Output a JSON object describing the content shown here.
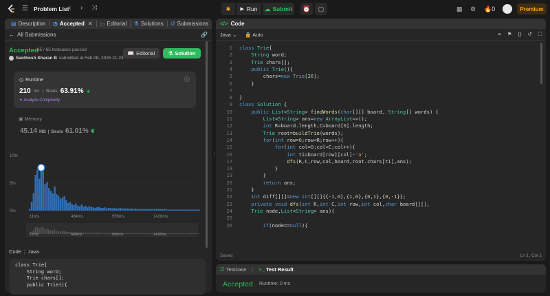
{
  "topbar": {
    "problem_list": "Problem List",
    "run": "Run",
    "submit": "Submit",
    "streak": "0",
    "premium": "Premium"
  },
  "left": {
    "tabs": [
      "Description",
      "Accepted",
      "Editorial",
      "Solutions",
      "Submissions"
    ],
    "all_submissions": "All Submissions",
    "status": "Accepted",
    "passed": "65 / 65 testcases passed",
    "user": "Santhosh Sharan B",
    "submitted": "submitted at Feb 08, 2025 21:23",
    "editorial_btn": "Editorial",
    "solution_btn": "Solution",
    "runtime_label": "Runtime",
    "runtime_value": "210",
    "runtime_unit": "ms",
    "beats_label": "Beats",
    "runtime_pct": "63.91%",
    "analyze": "Analyze Complexity",
    "memory_label": "Memory",
    "memory_value": "45.14",
    "memory_unit": "MB",
    "memory_pct": "61.01%",
    "code_label": "Code",
    "lang": "Java",
    "code_preview": "class Trie{\n    String word;\n    Trie chars[];\n    public Trie(){"
  },
  "chart_data": {
    "type": "bar",
    "ylabels": [
      "10%",
      "5%",
      "0%"
    ],
    "xlabels": [
      "11ms",
      "484ms",
      "956ms",
      "1428ms"
    ],
    "mini_xlabels": [
      "11ms",
      "484ms",
      "956ms",
      "1428ms"
    ],
    "values": [
      0.3,
      1.6,
      3.2,
      6.5,
      7.4,
      5.8,
      8.3,
      7.2,
      4.8,
      5.2,
      4.1,
      3.6,
      3.1,
      4.4,
      3.0,
      2.7,
      2.2,
      2.4,
      2.6,
      1.9,
      1.4,
      1.6,
      1.2,
      1.0,
      1.3,
      0.9,
      0.8,
      1.1,
      0.7,
      0.9,
      0.6,
      0.8,
      0.7,
      0.6,
      0.5,
      0.6,
      0.7,
      0.5,
      0.5,
      0.6,
      0.4,
      0.5,
      0.5,
      0.4,
      0.5,
      0.4,
      0.4,
      0.5,
      0.4,
      0.4,
      0.4,
      0.4,
      0.3,
      0.4,
      0.3,
      0.4,
      0.3,
      0.3,
      0.3,
      0.3,
      0.3,
      0.3,
      0.3,
      0.3,
      0.3,
      0.3,
      0.3,
      0.3,
      0.3,
      0.3,
      0.3,
      0.3,
      0.2,
      0.2,
      0.2,
      0.2,
      0.2,
      0.2,
      0.2,
      0.2,
      0.2,
      0.2,
      0.2,
      0.2,
      0.2,
      0.2,
      0.2,
      0.2,
      0.2,
      0.2,
      0.2,
      0.2,
      0.2,
      0.2,
      0.2
    ],
    "ymax": 10,
    "highlight_index": 6
  },
  "right": {
    "code_tab": "Code",
    "lang": "Java",
    "mode": "Auto",
    "status_left": "Saved",
    "status_right": "Ln 1, Col 1",
    "lines": [
      "class Trie{",
      "    String word;",
      "    Trie chars[];",
      "    public Trie(){",
      "        chars=new Trie[26];",
      "    }",
      "",
      "}",
      "class Solution {",
      "    public List<String> findWords(char[][] board, String[] words) {",
      "        List<String> ans=new ArrayList<>();",
      "        int R=board.length,C=board[0].length;",
      "        Trie root=buildTrie(words);",
      "        for(int row=0;row<R;row++){",
      "            for(int col=0;col<C;col++){",
      "                int ti=board[row][col]-'a';",
      "                dfs(R,C,row,col,board,root.chars[ti],ans);",
      "            }",
      "        }",
      "        return ans;",
      "    }",
      "    int diff[][]=new int[][]{{-1,0},{1,0},{0,1},{0,-1}};",
      "    private void dfs(int R,int C,int row,int col,char board[][],",
      "    Trie node,List<String> ans){",
      "",
      "        if(node==null){"
    ]
  },
  "bottom": {
    "testcase": "Testcase",
    "result": "Test Result",
    "status": "Accepted",
    "runtime": "Runtime: 0 ms"
  }
}
